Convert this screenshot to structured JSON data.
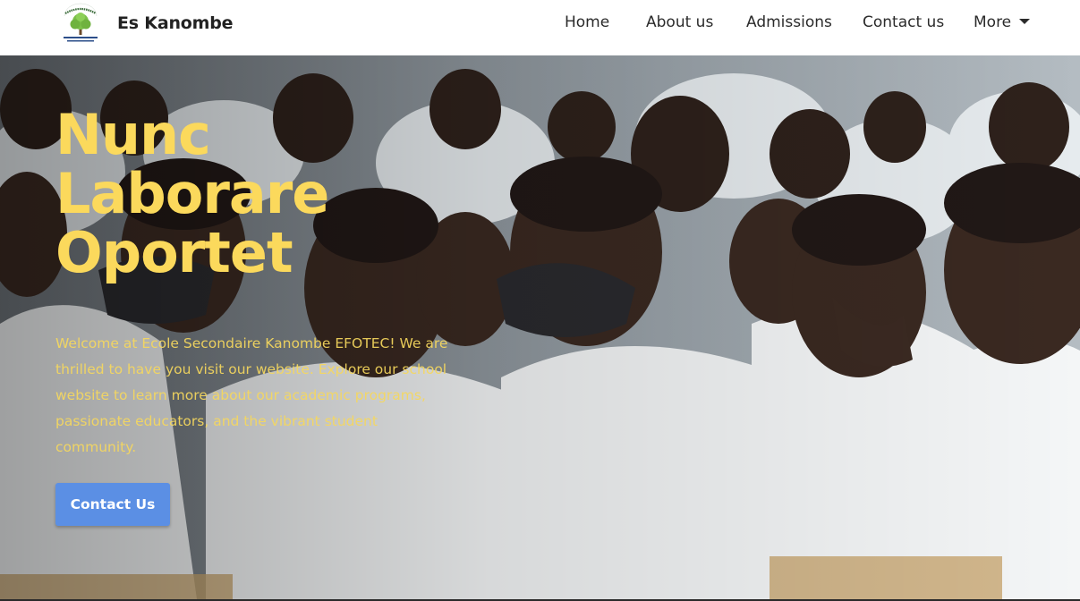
{
  "brand": {
    "name": "Es Kanombe",
    "logo_top_text": "NUNC LABORARE OPORTET",
    "logo_bottom_text": "E.S. KANOMBE /EFOTEC"
  },
  "nav": {
    "items": [
      {
        "label": "Home"
      },
      {
        "label": "About us"
      },
      {
        "label": "Admissions"
      },
      {
        "label": "Contact us"
      },
      {
        "label": "More"
      }
    ]
  },
  "hero": {
    "title": "Nunc Laborare Oportet",
    "text": "Welcome at Ecole Secondaire Kanombe EFOTEC! We are thrilled to have you visit our website. Explore our school website to learn more about our academic programs, passionate educators, and the vibrant student community.",
    "cta_label": "Contact Us"
  },
  "colors": {
    "accent_yellow": "#fbd95c",
    "button_blue": "#5b8fe4",
    "nav_text": "#2b2b2b"
  }
}
